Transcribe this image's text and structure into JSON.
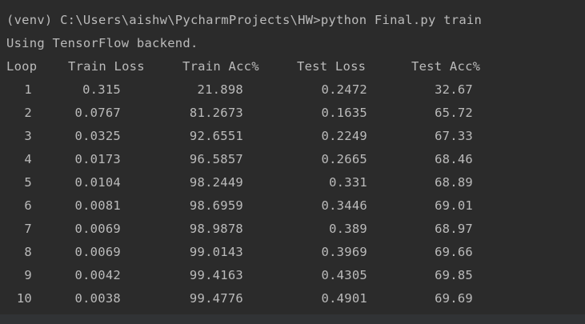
{
  "terminal": {
    "command_line": "(venv) C:\\Users\\aishw\\PycharmProjects\\HW>python Final.py train",
    "backend_message": "Using TensorFlow backend."
  },
  "table": {
    "headers": [
      "Loop",
      "Train Loss",
      "Train Acc%",
      "Test Loss",
      "Test Acc%"
    ],
    "rows": [
      [
        "1",
        "0.315",
        "21.898",
        "0.2472",
        "32.67"
      ],
      [
        "2",
        "0.0767",
        "81.2673",
        "0.1635",
        "65.72"
      ],
      [
        "3",
        "0.0325",
        "92.6551",
        "0.2249",
        "67.33"
      ],
      [
        "4",
        "0.0173",
        "96.5857",
        "0.2665",
        "68.46"
      ],
      [
        "5",
        "0.0104",
        "98.2449",
        "0.331",
        "68.89"
      ],
      [
        "6",
        "0.0081",
        "98.6959",
        "0.3446",
        "69.01"
      ],
      [
        "7",
        "0.0069",
        "98.9878",
        "0.389",
        "68.97"
      ],
      [
        "8",
        "0.0069",
        "99.0143",
        "0.3969",
        "69.66"
      ],
      [
        "9",
        "0.0042",
        "99.4163",
        "0.4305",
        "69.85"
      ],
      [
        "10",
        "0.0038",
        "99.4776",
        "0.4901",
        "69.69"
      ]
    ]
  }
}
